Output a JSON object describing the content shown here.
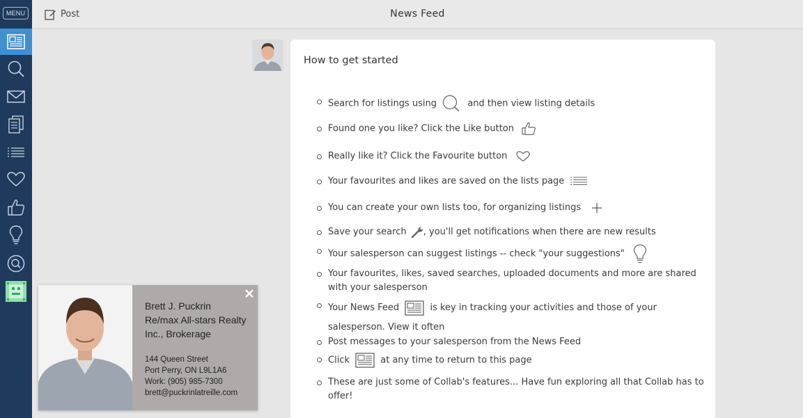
{
  "sidebar": {
    "menu_label": "MENU",
    "items": [
      {
        "icon": "newspaper-icon",
        "active": true
      },
      {
        "icon": "search-icon"
      },
      {
        "icon": "mail-icon"
      },
      {
        "icon": "documents-icon"
      },
      {
        "icon": "list-icon"
      },
      {
        "icon": "heart-icon"
      },
      {
        "icon": "thumbs-up-icon"
      },
      {
        "icon": "lightbulb-icon"
      },
      {
        "icon": "search-circle-icon"
      },
      {
        "icon": "app-avatar-icon"
      }
    ]
  },
  "topbar": {
    "post_label": "Post",
    "title": "News Feed"
  },
  "card": {
    "title": "How to get started",
    "tips": [
      {
        "a": "Search for listings using",
        "icon": "search-icon",
        "b": "and then view listing details"
      },
      {
        "a": "Found one you like? Click the Like button",
        "icon": "thumbs-up-icon",
        "b": ""
      },
      {
        "a": "Really like it? Click the Favourite button",
        "icon": "heart-icon",
        "b": ""
      },
      {
        "a": "Your favourites and likes are saved on the lists page",
        "icon": "list-icon",
        "b": ""
      },
      {
        "a": "You can create your own lists too, for organizing listings",
        "icon": "plus-icon",
        "b": ""
      },
      {
        "a": "Save your search",
        "icon": "wrench-icon",
        "b": ", you'll get notifications when there are new results"
      },
      {
        "a": "Your salesperson can suggest listings -- check \"your suggestions\"",
        "icon": "lightbulb-icon",
        "b": ""
      },
      {
        "a": "Your favourites, likes, saved searches, uploaded documents and more are shared with your salesperson",
        "icon": "",
        "b": ""
      },
      {
        "a": "Your News Feed",
        "icon": "newspaper-icon",
        "b": "is key in tracking your activities and those of your salesperson. View it often"
      },
      {
        "a": "Post messages to your salesperson from the News Feed",
        "icon": "",
        "b": ""
      },
      {
        "a": "Click",
        "icon": "newspaper-icon",
        "b": "at any time to return to this page"
      },
      {
        "a": "These are just some of Collab's features... Have fun exploring all that Collab has to offer!",
        "icon": "",
        "b": ""
      }
    ]
  },
  "contact": {
    "name": "Brett J. Puckrin",
    "company_line1": "Re/max All-stars Realty",
    "company_line2": "Inc., Brokerage",
    "address": "144 Queen Street",
    "city": "Port Perry, ON L9L1A6",
    "work": "Work: (905) 985-7300",
    "email": "brett@puckrinlatreille.com"
  }
}
